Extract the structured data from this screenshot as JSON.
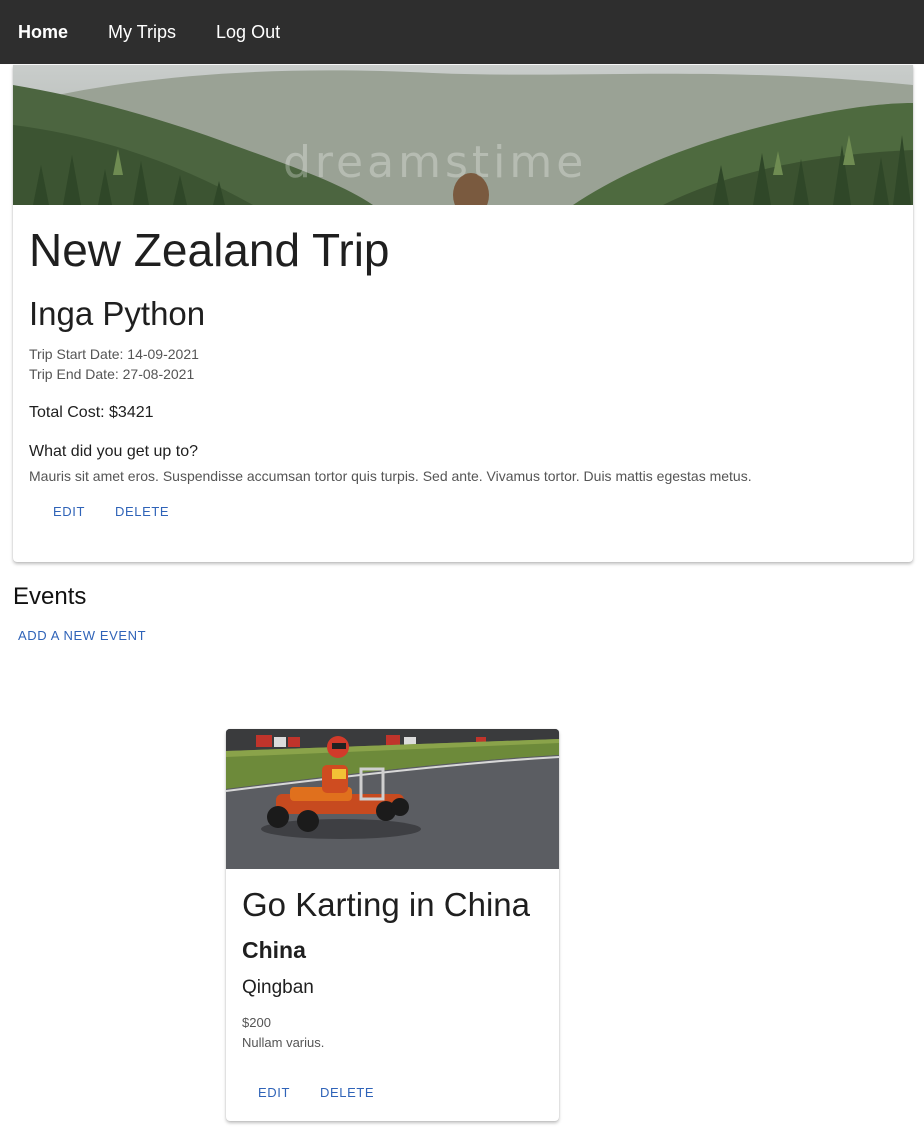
{
  "nav": {
    "home": "Home",
    "my_trips": "My Trips",
    "log_out": "Log Out"
  },
  "trip": {
    "hero_watermark": "dreamstime",
    "title": "New Zealand Trip",
    "owner": "Inga Python",
    "start_date": "Trip Start Date: 14-09-2021",
    "end_date": "Trip End Date: 27-08-2021",
    "total_cost": "Total Cost: $3421",
    "question": "What did you get up to?",
    "description": "Mauris sit amet eros. Suspendisse accumsan tortor quis turpis. Sed ante. Vivamus tortor. Duis mattis egestas metus.",
    "edit_label": "EDIT",
    "delete_label": "DELETE"
  },
  "events": {
    "heading": "Events",
    "add_label": "ADD A NEW EVENT",
    "items": [
      {
        "title": "Go Karting in China",
        "country": "China",
        "city": "Qingban",
        "cost": "$200",
        "description": "Nullam varius.",
        "edit_label": "EDIT",
        "delete_label": "DELETE"
      }
    ]
  },
  "colors": {
    "navbar": "#2e2e2e",
    "accent": "#2f63b8"
  }
}
